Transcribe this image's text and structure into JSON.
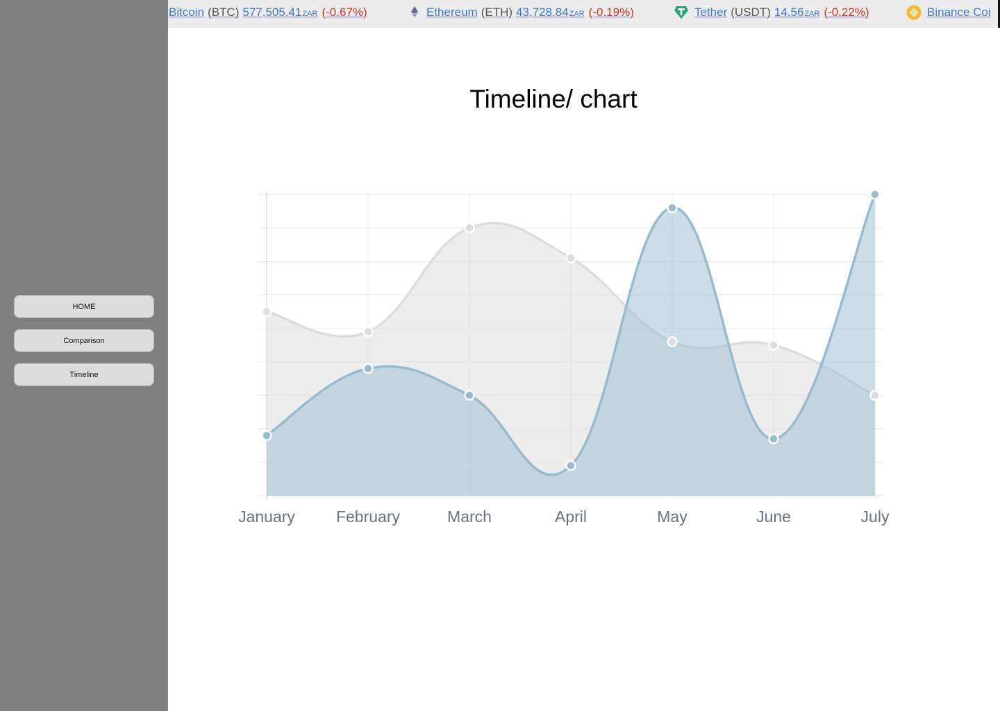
{
  "sidebar": {
    "buttons": [
      {
        "label": "HOME"
      },
      {
        "label": "Comparison"
      },
      {
        "label": "Timeline"
      }
    ]
  },
  "ticker": {
    "items": [
      {
        "name": "Bitcoin",
        "symbol": "(BTC)",
        "price": "577,505.41",
        "currency": "ZAR",
        "change": "(-0.67%)",
        "icon": "bitcoin-icon"
      },
      {
        "name": "Ethereum",
        "symbol": "(ETH)",
        "price": "43,728.84",
        "currency": "ZAR",
        "change": "(-0.19%)",
        "icon": "ethereum-icon"
      },
      {
        "name": "Tether",
        "symbol": "(USDT)",
        "price": "14.56",
        "currency": "ZAR",
        "change": "(-0.22%)",
        "icon": "tether-icon"
      },
      {
        "name": "Binance Coi",
        "symbol": "",
        "price": "",
        "currency": "",
        "change": "",
        "icon": "binance-coin-icon"
      }
    ],
    "colors": {
      "link": "#3b78c4",
      "negative": "#d0332c"
    }
  },
  "page": {
    "title": "Timeline/ chart"
  },
  "chart_data": {
    "type": "area",
    "title": "",
    "xlabel": "",
    "ylabel": "",
    "categories": [
      "January",
      "February",
      "March",
      "April",
      "May",
      "June",
      "July"
    ],
    "ylim": [
      0,
      90
    ],
    "grid": true,
    "legend": "none",
    "series": [
      {
        "values": [
          55,
          49,
          80,
          71,
          46,
          45,
          30
        ],
        "color": "#dcdcdc",
        "fill": "rgba(220,220,220,0.5)"
      },
      {
        "values": [
          18,
          38,
          30,
          9,
          86,
          17,
          90
        ],
        "color": "#97bbcd",
        "fill": "rgba(151,187,205,0.5)"
      }
    ]
  }
}
